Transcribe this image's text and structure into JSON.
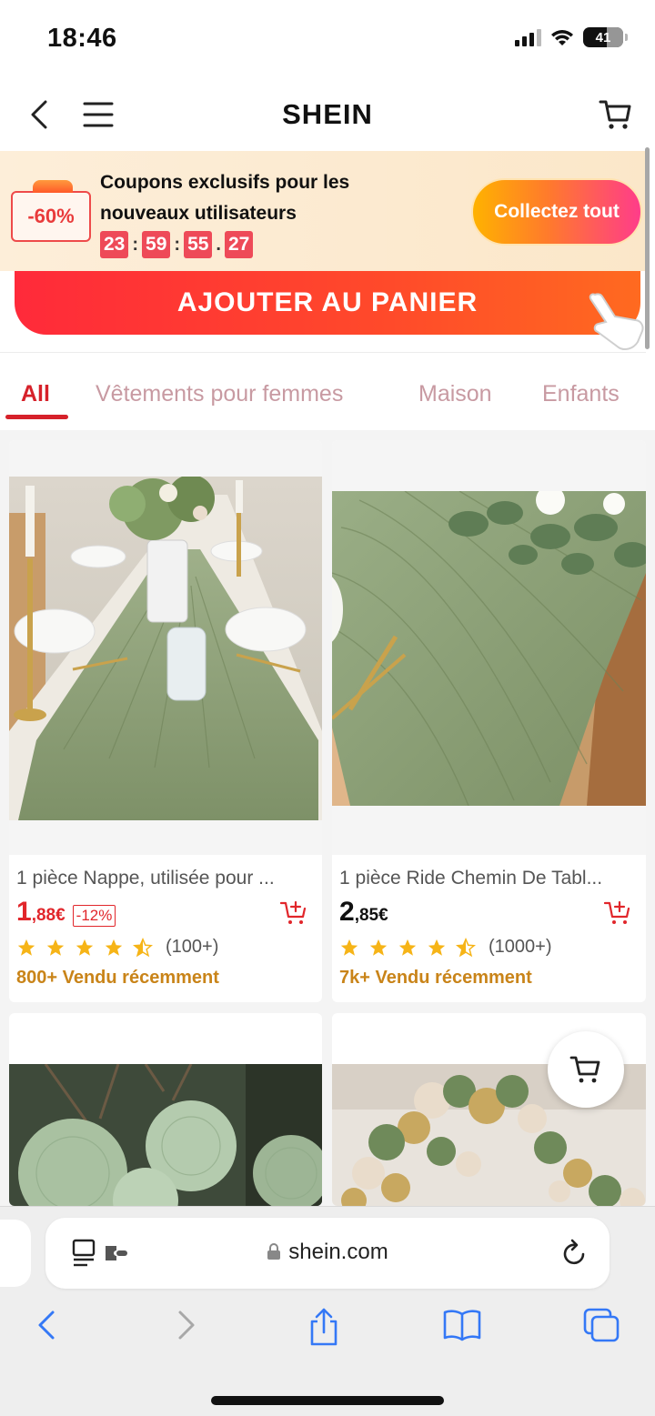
{
  "status_bar": {
    "time": "18:46",
    "battery": "41",
    "battery_level": 0.41
  },
  "header": {
    "logo": "SHEIN"
  },
  "coupon": {
    "badge": "-60%",
    "title": "Coupons exclusifs pour les nouveaux utilisateurs",
    "countdown": {
      "hours": "23",
      "minutes": "59",
      "seconds": "55",
      "hundredths": "27"
    },
    "collect_button": "Collectez tout"
  },
  "add_to_cart": "AJOUTER AU PANIER",
  "tabs": [
    {
      "label": "All",
      "active": true
    },
    {
      "label": "Vêtements pour femmes",
      "active": false
    },
    {
      "label": "Maison",
      "active": false
    },
    {
      "label": "Enfants",
      "active": false
    }
  ],
  "products": [
    {
      "title": "1 pièce Nappe, utilisée pour ...",
      "price_int": "1",
      "price_dec": ",88€",
      "discount": "-12%",
      "rating": 4.5,
      "reviews": "(100+)",
      "sold": "800+ Vendu récemment"
    },
    {
      "title": "1 pièce Ride Chemin De Tabl...",
      "price_int": "2",
      "price_dec": ",85€",
      "discount": "",
      "rating": 4.5,
      "reviews": "(1000+)",
      "sold": "7k+ Vendu récemment"
    }
  ],
  "browser": {
    "url": "shein.com"
  },
  "colors": {
    "brand_red": "#d6212a",
    "sale_red": "#e1262b",
    "sold_gold": "#c98419",
    "ios_blue": "#3478f6"
  }
}
